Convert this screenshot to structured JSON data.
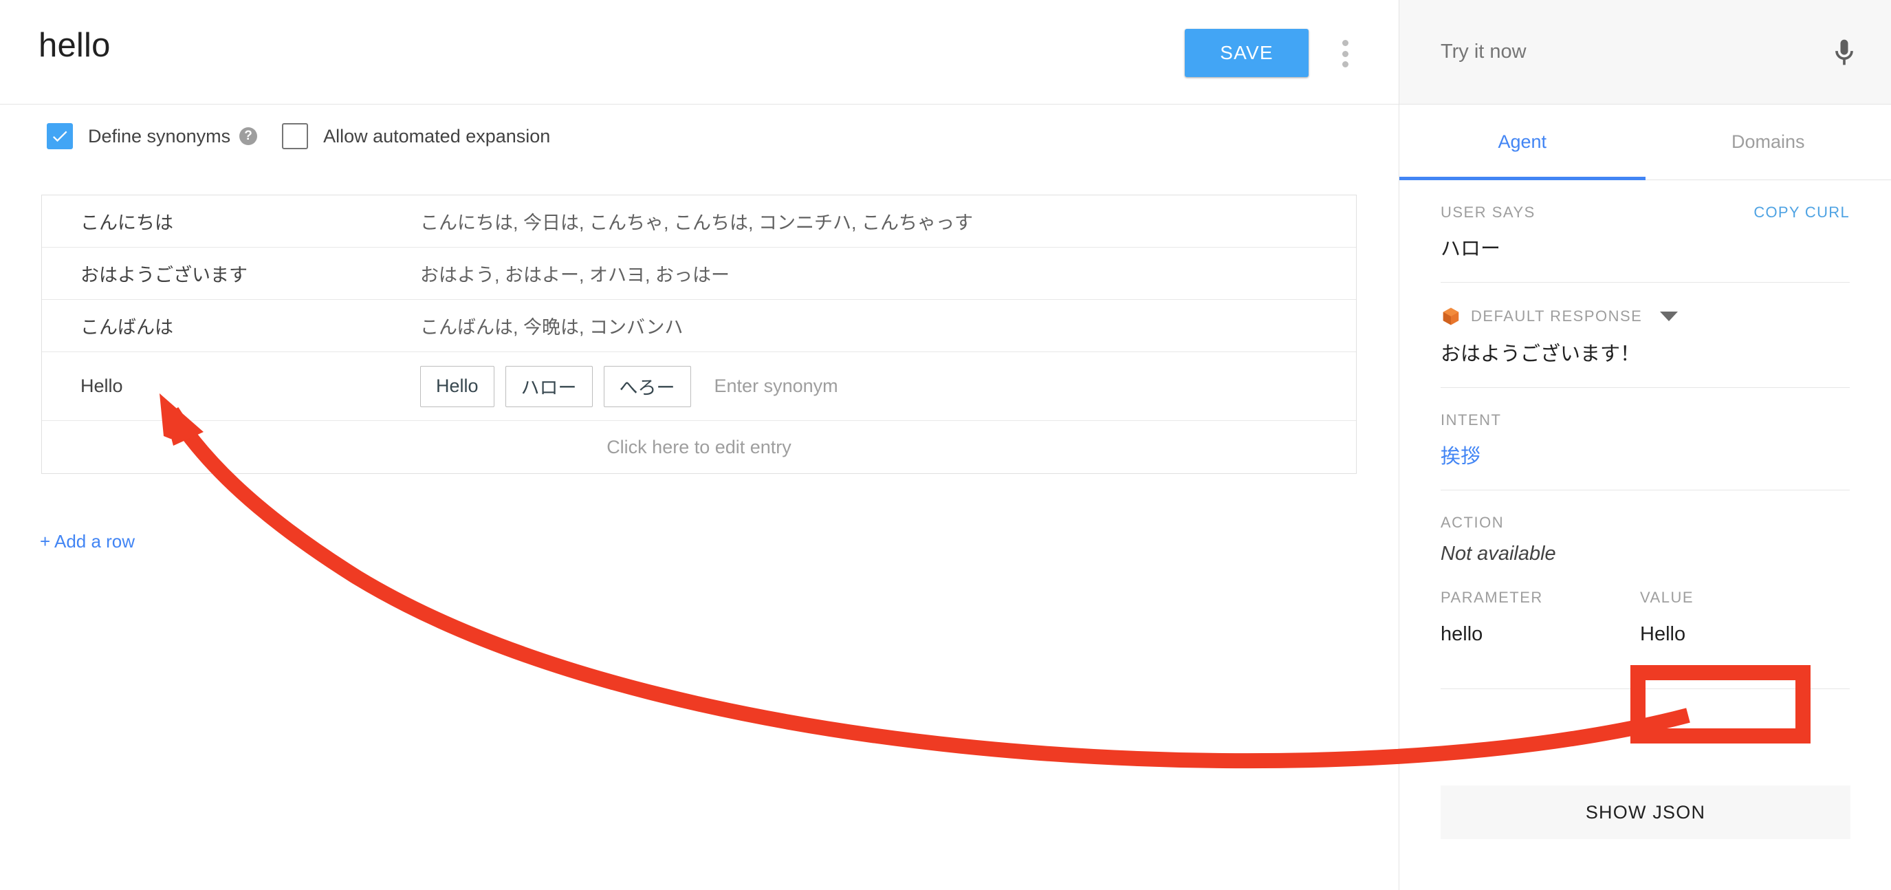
{
  "header": {
    "title": "hello",
    "save_label": "SAVE",
    "more_icon": "kebab-menu-icon"
  },
  "options": {
    "define_synonyms": {
      "label": "Define synonyms",
      "checked": true,
      "help_glyph": "?"
    },
    "allow_expansion": {
      "label": "Allow automated expansion",
      "checked": false
    }
  },
  "synonyms_table": {
    "rows": [
      {
        "key": "こんにちは",
        "values": "こんにちは, 今日は, こんちゃ, こんちは, コンニチハ, こんちゃっす"
      },
      {
        "key": "おはようございます",
        "values": "おはよう, おはよー, オハヨ, おっはー"
      },
      {
        "key": "こんばんは",
        "values": "こんばんは, 今晩は, コンバンハ"
      }
    ],
    "editing_row": {
      "key": "Hello",
      "chips": [
        "Hello",
        "ハロー",
        "へろー"
      ],
      "input_placeholder": "Enter synonym"
    },
    "edit_hint": "Click here to edit entry",
    "add_row_label": "+ Add a row"
  },
  "side_panel": {
    "try_it_placeholder": "Try it now",
    "mic_icon": "microphone-icon",
    "tabs": [
      {
        "label": "Agent",
        "active": true
      },
      {
        "label": "Domains",
        "active": false
      }
    ],
    "user_says": {
      "label": "USER SAYS",
      "copy_curl_label": "COPY CURL",
      "value": "ハロー"
    },
    "default_response": {
      "label": "DEFAULT RESPONSE",
      "icon": "orange-cube-icon",
      "caret_icon": "chevron-down-icon",
      "value": "おはようございます！"
    },
    "intent": {
      "label": "INTENT",
      "value": "挨拶"
    },
    "action": {
      "label": "ACTION",
      "value": "Not available"
    },
    "parameters": {
      "parameter_label": "PARAMETER",
      "value_label": "VALUE",
      "rows": [
        {
          "parameter": "hello",
          "value": "Hello"
        }
      ]
    },
    "show_json_label": "SHOW JSON"
  },
  "annotation": {
    "highlight_color": "#ef3b23",
    "arrow_color": "#ef3b23"
  },
  "colors": {
    "accent_blue": "#42a5f5",
    "link_blue": "#4285f4",
    "cube_orange": "#e8762c"
  }
}
